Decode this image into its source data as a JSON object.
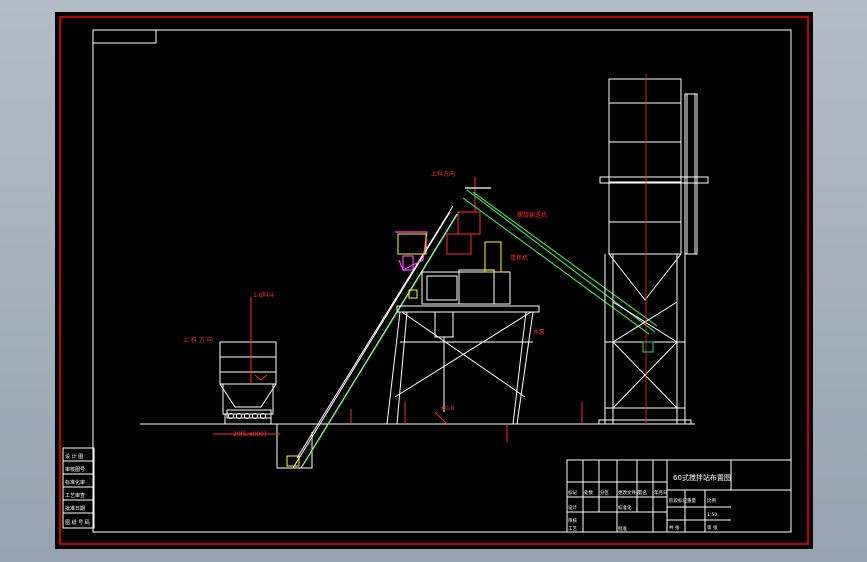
{
  "drawing": {
    "title": "60式搅拌站布置图",
    "background_color": "#000000",
    "frame_color": "#ff0000",
    "line_color": "#ffffff",
    "annotation_color": "#ff2a2a",
    "conveyor_color": "#39d353",
    "hopper_color": "#ff40ff",
    "mixer_color": "#ffff00"
  },
  "labels": {
    "aggregate_hopper": "上 料 方 向",
    "aggregate_bin": "1.6料斗",
    "feeding_direction": "上料方向",
    "dimension_span": "20[5,4000]",
    "cement_screw": "螺旋输送机",
    "mixer_label": "搅拌机",
    "water_label": "水泵",
    "belt_label": "斗提",
    "silo_label": "",
    "ground_mark": "±0.0"
  },
  "left_table": {
    "rows": [
      "设 计 图",
      "审核图号",
      "标准化审",
      "工艺审查",
      "批准日期",
      "图 纸 号 码"
    ]
  },
  "title_block": {
    "drawing_name": "60式搅拌站布置图",
    "row_left_1": [
      "标记",
      "处数",
      "分区",
      "更改文件号",
      "签名",
      "年月日"
    ],
    "row_left_2": [
      "设计",
      "",
      "标准化",
      "",
      "",
      ""
    ],
    "row_left_3": [
      "审核",
      "",
      "",
      "",
      "",
      ""
    ],
    "row_left_4": [
      "工艺",
      "",
      "批准",
      "",
      "",
      ""
    ],
    "stage_row": [
      "阶段标记",
      "重量",
      "比例"
    ],
    "scale_value": "1:50",
    "sheet_row": [
      "共 张",
      "第 张"
    ]
  }
}
